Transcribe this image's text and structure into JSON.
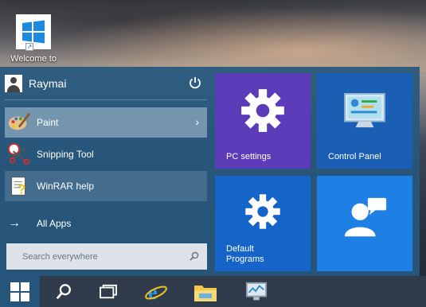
{
  "desktop": {
    "icon_label": "Welcome to",
    "icon_name": "windows-logo-icon"
  },
  "start_menu": {
    "user": {
      "name": "Raymai",
      "avatar_icon": "user-avatar-icon",
      "power_icon": "power-icon"
    },
    "apps": [
      {
        "label": "Paint",
        "icon": "paint-palette-icon",
        "has_submenu": true,
        "state": "selected"
      },
      {
        "label": "Snipping Tool",
        "icon": "scissors-icon",
        "has_submenu": false,
        "state": "normal"
      },
      {
        "label": "WinRAR help",
        "icon": "help-document-icon",
        "has_submenu": false,
        "state": "hover"
      }
    ],
    "submenu_glyph": "›",
    "all_apps": {
      "label": "All Apps",
      "glyph": "→"
    },
    "search": {
      "placeholder": "Search everywhere",
      "value": ""
    },
    "tiles": [
      {
        "label": "PC settings",
        "icon": "gear-icon",
        "color": "#5b3bb8"
      },
      {
        "label": "Control Panel",
        "icon": "control-panel-icon",
        "color": "#1a5fb4"
      },
      {
        "label": "Default Programs",
        "icon": "gear-icon",
        "color": "#1565c8"
      },
      {
        "label": "",
        "icon": "people-chat-icon",
        "color": "#1e7fe4"
      }
    ]
  },
  "taskbar": {
    "items": [
      "start-windows-icon",
      "search-icon",
      "task-view-icon",
      "internet-explorer-icon",
      "file-explorer-icon",
      "monitor-icon"
    ]
  },
  "colors": {
    "start_menu_bg": "#27587e",
    "selected_item": "#96afc4",
    "taskbar_bg": "#323e4e"
  }
}
